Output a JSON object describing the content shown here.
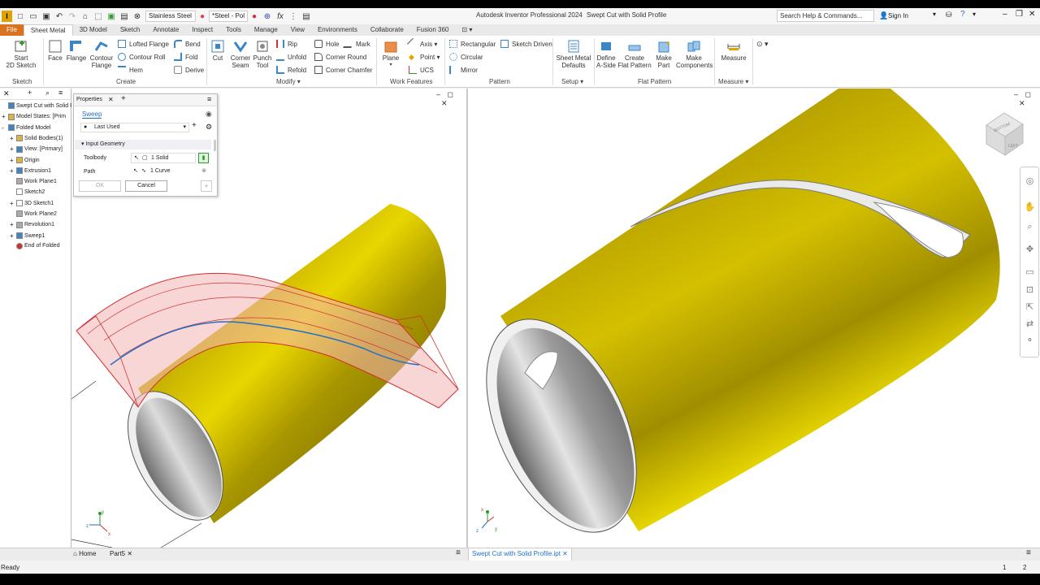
{
  "title_bar": {
    "material": "Stainless Steel",
    "appearance": "*Steel - Pol",
    "app_title": "Autodesk Inventor Professional 2024",
    "doc_title": "Swept Cut with Solid Profile",
    "search_placeholder": "Search Help & Commands...",
    "sign_in": "Sign In"
  },
  "tabs": [
    "File",
    "Sheet Metal",
    "3D Model",
    "Sketch",
    "Annotate",
    "Inspect",
    "Tools",
    "Manage",
    "View",
    "Environments",
    "Collaborate",
    "Fusion 360"
  ],
  "ribbon": {
    "sketch": {
      "start_sketch": "Start\n2D Sketch",
      "group": "Sketch"
    },
    "create": {
      "face": "Face",
      "flange": "Flange",
      "contour_flange": "Contour\nFlange",
      "lofted_flange": "Lofted Flange",
      "contour_roll": "Contour Roll",
      "hem": "Hem",
      "bend": "Bend",
      "fold": "Fold",
      "derive": "Derive",
      "group": "Create"
    },
    "modify": {
      "cut": "Cut",
      "corner_seam": "Corner\nSeam",
      "punch_tool": "Punch\nTool",
      "rip": "Rip",
      "unfold": "Unfold",
      "refold": "Refold",
      "hole": "Hole",
      "mark": "Mark",
      "corner_round": "Corner Round",
      "corner_chamfer": "Corner Chamfer",
      "group": "Modify"
    },
    "work_features": {
      "plane": "Plane",
      "axis": "Axis",
      "point": "Point",
      "ucs": "UCS",
      "group": "Work Features"
    },
    "pattern": {
      "rectangular": "Rectangular",
      "circular": "Circular",
      "mirror": "Mirror",
      "sketch_driven": "Sketch Driven",
      "group": "Pattern"
    },
    "setup": {
      "sheet_metal_defaults": "Sheet Metal\nDefaults",
      "group": "Setup"
    },
    "flat_pattern": {
      "define_a_side": "Define\nA-Side",
      "create_flat_pattern": "Create\nFlat Pattern",
      "make_part": "Make\nPart",
      "make_components": "Make\nComponents",
      "group": "Flat Pattern"
    },
    "measure": {
      "measure": "Measure",
      "group": "Measure"
    }
  },
  "browser": {
    "items": [
      {
        "label": "Swept Cut with Solid Pr",
        "icon": "part-icon"
      },
      {
        "label": "Model States: [Prim",
        "icon": "folder-icon"
      },
      {
        "label": "Folded Model",
        "icon": "folded-model-icon"
      },
      {
        "label": "Solid Bodies(1)",
        "icon": "folder-icon"
      },
      {
        "label": "View: [Primary]",
        "icon": "view-icon"
      },
      {
        "label": "Origin",
        "icon": "folder-icon"
      },
      {
        "label": "Extrusion1",
        "icon": "extrusion-icon"
      },
      {
        "label": "Work Plane1",
        "icon": "work-plane-icon"
      },
      {
        "label": "Sketch2",
        "icon": "sketch-icon"
      },
      {
        "label": "3D Sketch1",
        "icon": "sketch-3d-icon"
      },
      {
        "label": "Work Plane2",
        "icon": "work-plane-icon"
      },
      {
        "label": "Revolution1",
        "icon": "revolution-icon"
      },
      {
        "label": "Sweep1",
        "icon": "sweep-icon"
      },
      {
        "label": "End of Folded",
        "icon": "end-of-part-icon"
      }
    ]
  },
  "properties": {
    "panel_title": "Properties",
    "command": "Sweep",
    "preset": "Last Used",
    "section": "Input Geometry",
    "toolbody_label": "Toolbody",
    "toolbody_value": "1 Solid",
    "path_label": "Path",
    "path_value": "1 Curve",
    "ok": "OK",
    "cancel": "Cancel"
  },
  "viewcube": {
    "top_face": "BOTTOM",
    "right_face": "LEFT"
  },
  "doc_tabs": {
    "home": "Home",
    "part5": "Part5",
    "active_doc": "Swept Cut with Solid Profile.ipt"
  },
  "status": {
    "text": "Ready",
    "count1": "1",
    "count2": "2"
  },
  "colors": {
    "accent_orange": "#d9731e",
    "brass": "#b8a200",
    "blue_link": "#1f6fc5",
    "sweep_pink": "#f4b4b4"
  }
}
